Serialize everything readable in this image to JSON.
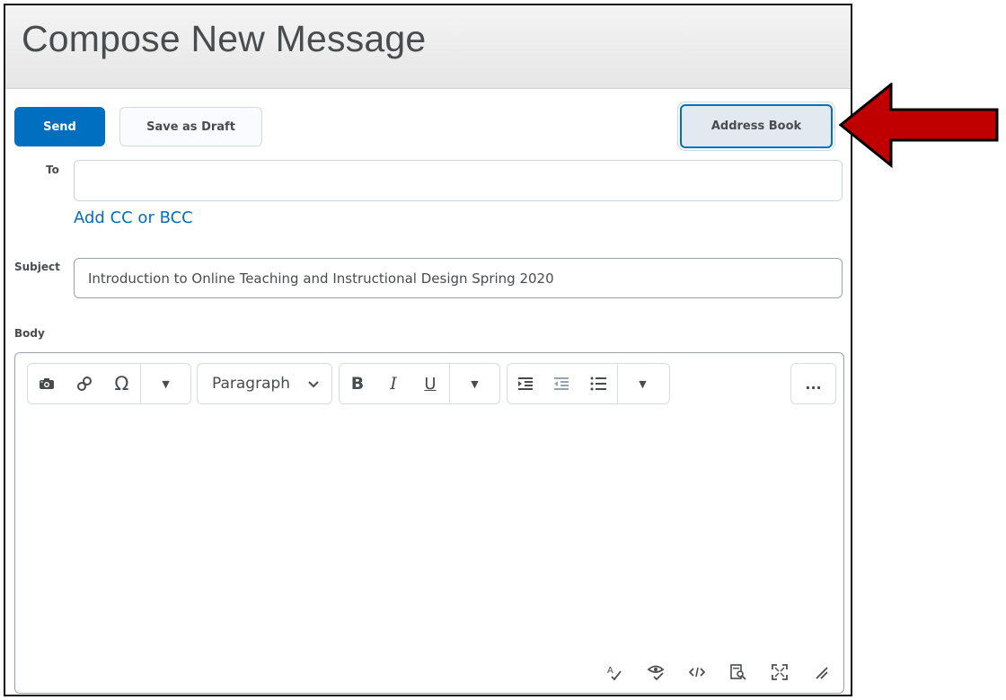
{
  "header": {
    "title": "Compose New Message"
  },
  "toolbar": {
    "send_label": "Send",
    "draft_label": "Save as Draft",
    "address_book_label": "Address Book"
  },
  "fields": {
    "to_label": "To",
    "to_value": "",
    "cc_link": "Add CC or BCC",
    "subject_label": "Subject",
    "subject_value": "Introduction to Online Teaching and Instructional Design Spring 2020",
    "body_label": "Body"
  },
  "editor": {
    "format_select_value": "Paragraph",
    "bold": "B",
    "italic": "I",
    "underline": "U",
    "more": "..."
  },
  "icons": [
    "insert-image-icon",
    "insert-link-icon",
    "special-character-icon",
    "more-insert-caret-icon",
    "paragraph-caret-icon",
    "bold-icon",
    "italic-icon",
    "underline-icon",
    "more-format-caret-icon",
    "indent-icon",
    "outdent-icon",
    "list-icon",
    "more-list-caret-icon",
    "more-actions-icon",
    "spellcheck-icon",
    "accessibility-check-icon",
    "source-code-icon",
    "preview-icon",
    "fullscreen-icon",
    "resize-handle-icon"
  ],
  "colors": {
    "primary": "#006fbf",
    "arrow_fill": "#c00000",
    "address_book_bg": "#e3e9f1"
  }
}
